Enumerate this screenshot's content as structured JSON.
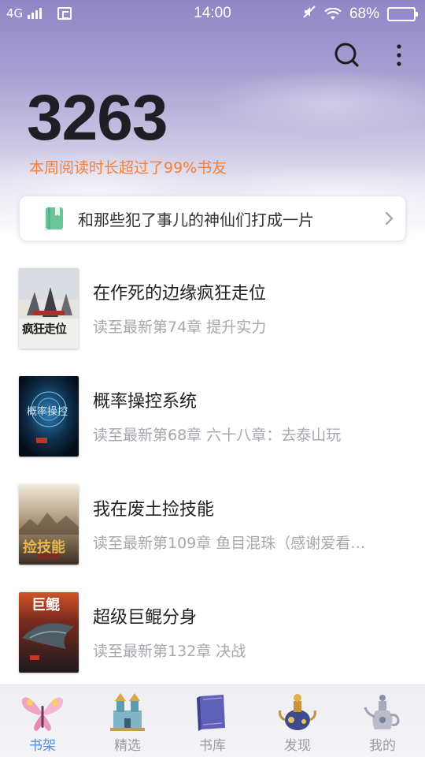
{
  "status_bar": {
    "network": "4G",
    "time": "14:00",
    "battery": "68%",
    "battery_level": 0.68
  },
  "header": {
    "reading_minutes": "3263",
    "rank_text": "本周阅读时长超过了99%书友",
    "icons": [
      "search-icon",
      "more-vertical-icon"
    ]
  },
  "banner": {
    "text": "和那些犯了事儿的神仙们打成一片"
  },
  "books": [
    {
      "title": "在作死的边缘疯狂走位",
      "progress": "读至最新第74章 提升实力",
      "cover_text": "疯狂走位"
    },
    {
      "title": "概率操控系统",
      "progress": "读至最新第68章 六十八章：去泰山玩",
      "cover_text": "概率操控"
    },
    {
      "title": "我在废土捡技能",
      "progress": "读至最新第109章 鱼目混珠（感谢爱看…",
      "cover_text": "捡技能"
    },
    {
      "title": "超级巨鲲分身",
      "progress": "读至最新第132章 决战",
      "cover_text": "巨鲲"
    }
  ],
  "tabs": [
    {
      "label": "书架",
      "icon": "butterfly-icon",
      "active": true
    },
    {
      "label": "精选",
      "icon": "castle-icon",
      "active": false
    },
    {
      "label": "书库",
      "icon": "book-icon",
      "active": false
    },
    {
      "label": "发现",
      "icon": "potion-icon",
      "active": false
    },
    {
      "label": "我的",
      "icon": "teapot-icon",
      "active": false
    }
  ],
  "colors": {
    "accent": "#f2803a",
    "tab_active": "#4a8fe2",
    "header_purple": "#8f86c6"
  }
}
